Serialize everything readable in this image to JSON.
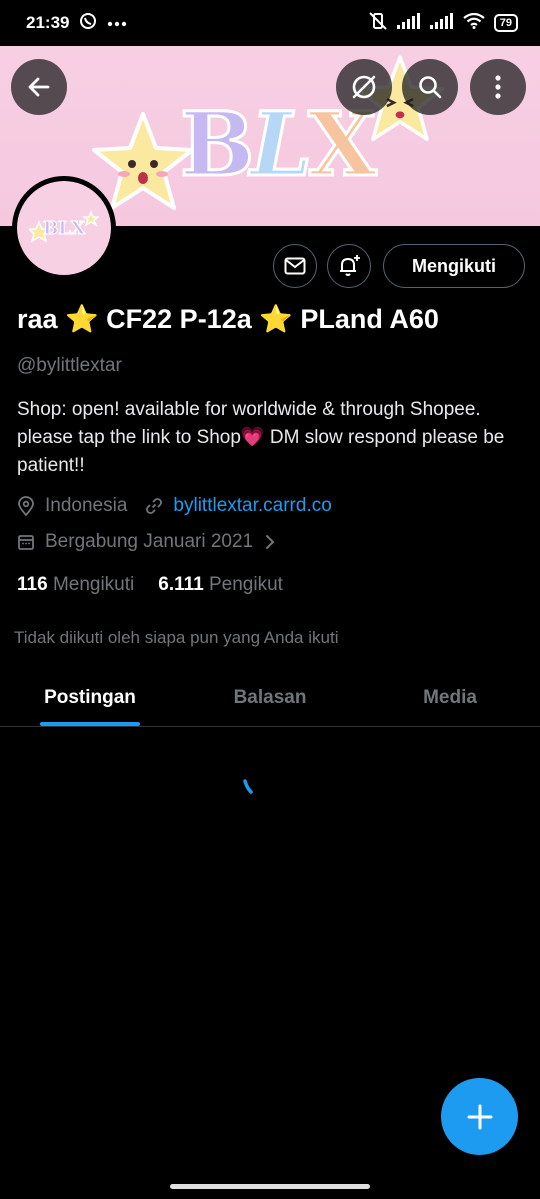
{
  "status_bar": {
    "time": "21:39",
    "battery": "79",
    "left_icons": [
      "whatsapp-icon",
      "more-dots-icon"
    ],
    "right_icons": [
      "mute-vibrate-icon",
      "signal-icon",
      "signal-icon",
      "wifi-icon",
      "battery-icon"
    ]
  },
  "banner": {
    "logo_b": "B",
    "logo_l": "L",
    "logo_x": "X"
  },
  "avatar": {
    "logo_text": "BLX"
  },
  "profile": {
    "display_name": "raa ⭐ CF22 P-12a ⭐ PLand A60",
    "handle": "@bylittlextar",
    "bio": "Shop: open! available for worldwide & through Shopee. please tap the link to Shop💗 DM slow respond please be patient!!",
    "location": "Indonesia",
    "website": "bylittlextar.carrd.co",
    "joined": "Bergabung Januari 2021",
    "following_count": "116",
    "following_label": "Mengikuti",
    "followers_count": "6.111",
    "followers_label": "Pengikut",
    "followed_note": "Tidak diikuti oleh siapa pun yang Anda ikuti"
  },
  "actions": {
    "follow_label": "Mengikuti"
  },
  "tabs": [
    {
      "label": "Postingan",
      "active": true
    },
    {
      "label": "Balasan",
      "active": false
    },
    {
      "label": "Media",
      "active": false
    }
  ],
  "colors": {
    "accent": "#1d9bf0",
    "background": "#000000",
    "muted_text": "#71767b",
    "banner_pink": "#f7cfe3"
  }
}
